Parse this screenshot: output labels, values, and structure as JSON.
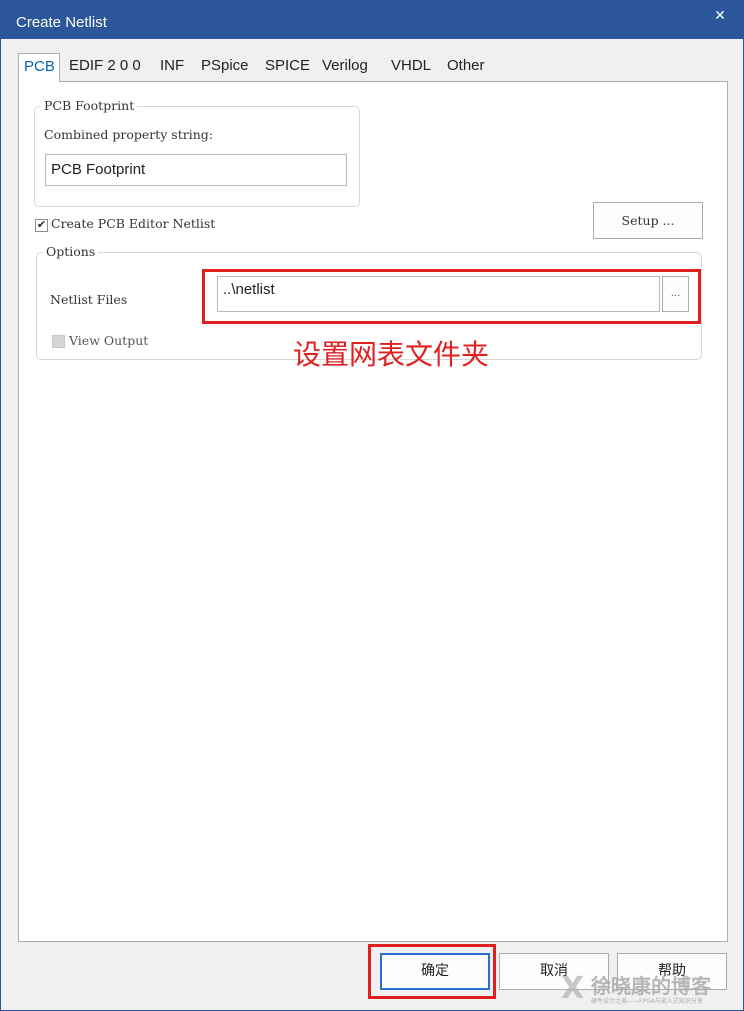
{
  "window": {
    "title": "Create Netlist",
    "close_icon": "close-icon",
    "titlebar_color": "#2b579a"
  },
  "tabs": [
    {
      "label": "PCB",
      "active": true
    },
    {
      "label": "EDIF 2 0 0",
      "active": false
    },
    {
      "label": "INF",
      "active": false
    },
    {
      "label": "PSpice",
      "active": false
    },
    {
      "label": "SPICE",
      "active": false
    },
    {
      "label": "Verilog",
      "active": false
    },
    {
      "label": "VHDL",
      "active": false
    },
    {
      "label": "Other",
      "active": false
    }
  ],
  "pcb_footprint": {
    "group_label": "PCB Footprint",
    "field_label": "Combined property string:",
    "field_value": "PCB Footprint"
  },
  "create_pcb_editor_netlist": {
    "label": "Create PCB Editor Netlist",
    "checked": true
  },
  "setup_button": {
    "label": "Setup ..."
  },
  "options": {
    "group_label": "Options",
    "netlist_dir_label": "Netlist Files",
    "netlist_dir_value": "..\\netlist",
    "browse_label": "...",
    "view_output_label": "View Output",
    "view_output_checked": false,
    "view_output_enabled": false
  },
  "annotation": {
    "text": "设置网表文件夹",
    "color": "#e02020"
  },
  "footer": {
    "ok_label": "确定",
    "cancel_label": "取消",
    "help_label": "帮助"
  },
  "watermark": {
    "glyph": "X",
    "title": "徐晓康的博客",
    "subtitle": "硬件设计之美——FPGA与嵌入式知识分享"
  }
}
